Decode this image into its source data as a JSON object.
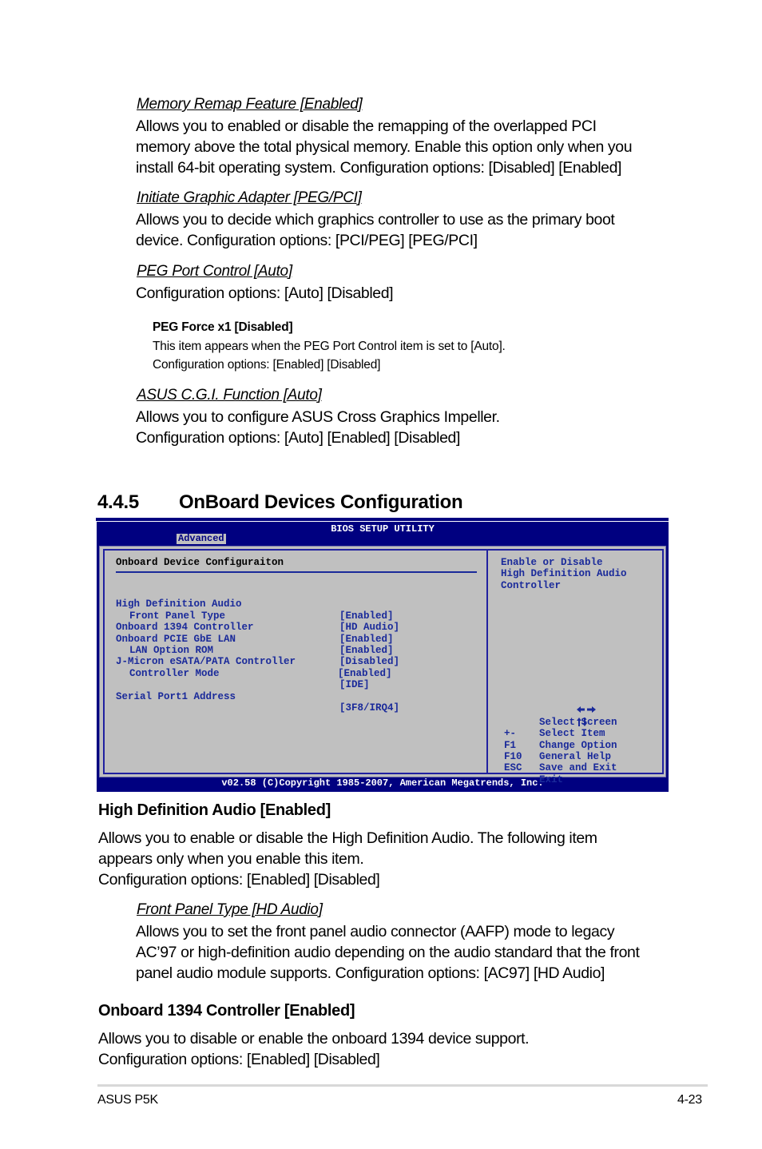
{
  "items_top": [
    {
      "title": "Memory Remap Feature [Enabled]",
      "lines": [
        "Allows you to enabled or disable the remapping of the overlapped PCI",
        "memory above the total physical memory. Enable this option only when you",
        "install 64-bit operating system. Configuration options: [Disabled] [Enabled]"
      ]
    },
    {
      "title": "Initiate Graphic Adapter [PEG/PCI]",
      "lines": [
        "Allows you to decide which graphics controller to use as the primary boot",
        "device. Configuration options: [PCI/PEG] [PEG/PCI]"
      ]
    },
    {
      "title": "PEG Port Control [Auto]",
      "lines": [
        "Configuration options: [Auto] [Disabled]"
      ]
    }
  ],
  "sub_item": {
    "title": "PEG Force x1 [Disabled]",
    "lines": [
      "This item appears when the PEG Port Control item is set to [Auto].",
      "Configuration options: [Enabled] [Disabled]"
    ]
  },
  "cgi_item": {
    "title": "ASUS C.G.I. Function [Auto]",
    "lines": [
      "Allows you to configure ASUS Cross Graphics Impeller.",
      "Configuration options: [Auto] [Enabled] [Disabled]"
    ]
  },
  "section": {
    "number": "4.4.5",
    "title": "OnBoard Devices Configuration"
  },
  "bios": {
    "title": "BIOS SETUP UTILITY",
    "active_tab": "Advanced",
    "panel_title": "Onboard Device Configuraiton",
    "settings": [
      {
        "label": "High Definition Audio",
        "value": "[Enabled]",
        "indent": false
      },
      {
        "label": "Front Panel Type",
        "value": "[HD Audio]",
        "indent": true
      },
      {
        "label": "Onboard 1394 Controller",
        "value": "[Enabled]",
        "indent": false
      },
      {
        "label": "Onboard PCIE GbE LAN",
        "value": "[Enabled]",
        "indent": false
      },
      {
        "label": "LAN Option ROM",
        "value": "[Disabled]",
        "indent": true
      },
      {
        "label": "J-Micron eSATA/PATA Controller",
        "value": "[Enabled]",
        "indent": false
      },
      {
        "label": "Controller Mode",
        "value": "[IDE]",
        "indent": true
      },
      {
        "label": "Serial Port1 Address",
        "value": "[3F8/IRQ4]",
        "indent": false
      }
    ],
    "help_lines": [
      "Enable or Disable",
      "High Definition Audio",
      "Controller"
    ],
    "keys": [
      {
        "key": "left-right-arrows",
        "label": "Select Screen"
      },
      {
        "key": "up-down-arrows",
        "label": "Select Item"
      },
      {
        "key": "+-",
        "label": "Change Option"
      },
      {
        "key": "F1",
        "label": "General Help"
      },
      {
        "key": "F10",
        "label": "Save and Exit"
      },
      {
        "key": "ESC",
        "label": "Exit"
      }
    ],
    "footer": "v02.58 (C)Copyright 1985-2007, American Megatrends, Inc."
  },
  "hda": {
    "heading": "High Definition Audio [Enabled]",
    "lines": [
      "Allows you to enable or disable the High Definition Audio. The following item",
      "appears only when you enable this item.",
      "Configuration options: [Enabled] [Disabled]"
    ]
  },
  "front_panel": {
    "title": "Front Panel Type [HD Audio]",
    "lines": [
      "Allows you to set the front panel audio connector (AAFP) mode to legacy",
      "AC’97 or high-definition audio depending on the audio standard that the front",
      "panel audio module supports. Configuration options: [AC97] [HD Audio]"
    ]
  },
  "ieee1394": {
    "heading": "Onboard 1394 Controller [Enabled]",
    "lines": [
      "Allows you to disable or enable the onboard 1394 device support.",
      "Configuration options: [Enabled] [Disabled]"
    ]
  },
  "footer": {
    "left": "ASUS P5K",
    "right": "4-23"
  }
}
